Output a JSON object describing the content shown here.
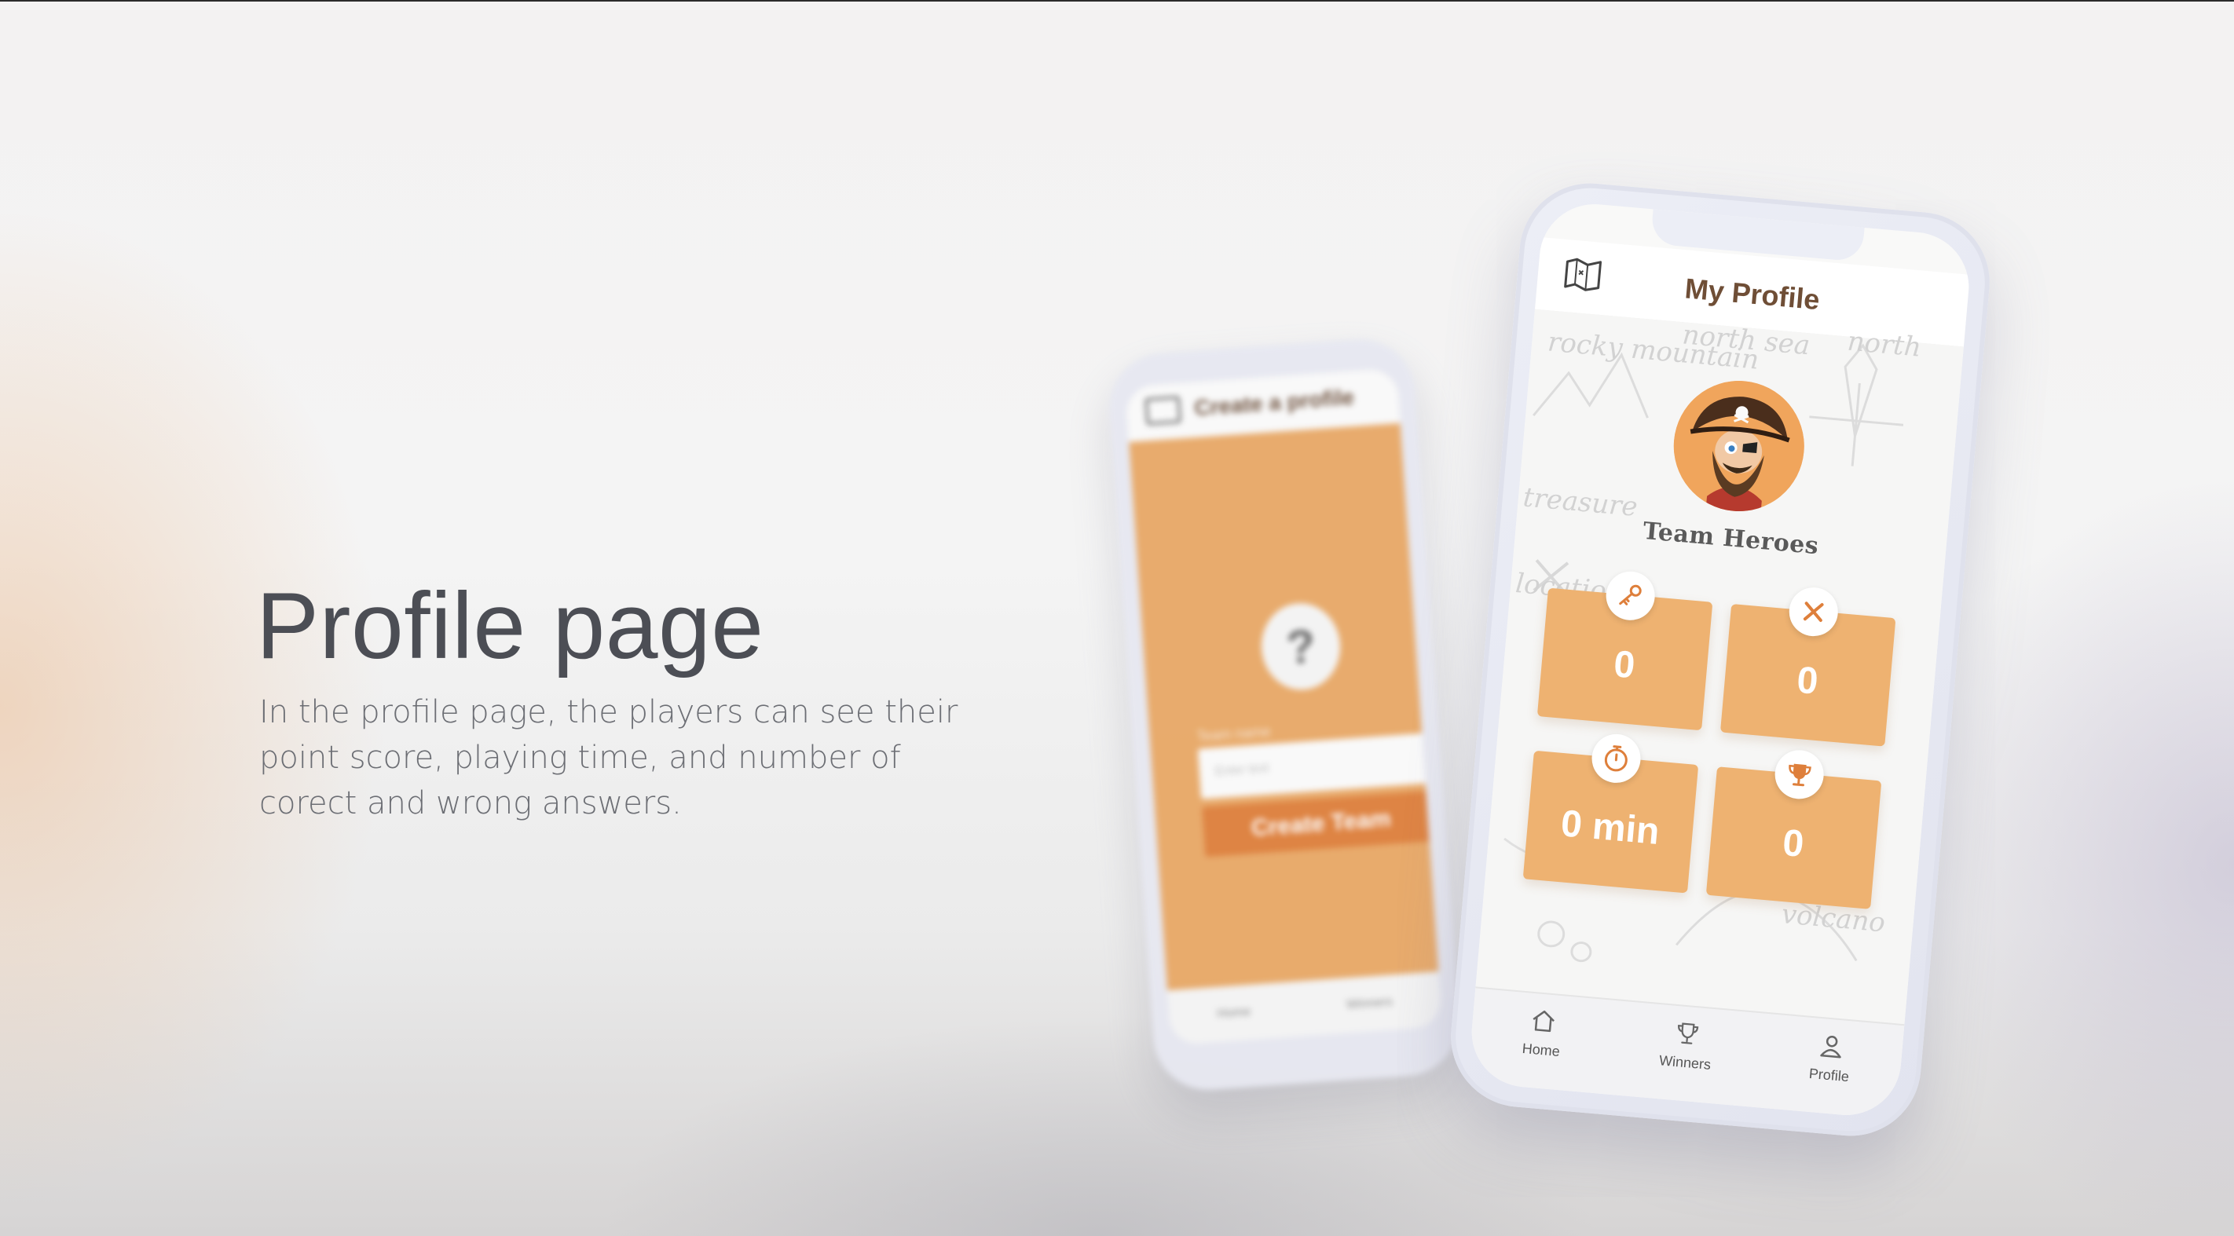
{
  "slide": {
    "title": "Profile page",
    "description": "In the profile page, the players can see their point score, playing time, and number of corect and wrong answers."
  },
  "back_phone": {
    "header_title": "Create a profile",
    "team_label": "Team name",
    "input_placeholder": "Enter text",
    "create_button": "Create Team",
    "nav": [
      "Home",
      "Winners"
    ]
  },
  "profile_screen": {
    "header_title": "My Profile",
    "team_name": "Team Heroes",
    "map_words": [
      "rocky mountain",
      "north sea",
      "north",
      "treasure",
      "location",
      "volcano"
    ],
    "stats": [
      {
        "icon": "key-icon",
        "value": "0"
      },
      {
        "icon": "wrong-x-icon",
        "value": "0"
      },
      {
        "icon": "stopwatch-icon",
        "value": "0 min"
      },
      {
        "icon": "trophy-icon",
        "value": "0"
      }
    ],
    "nav": {
      "home": "Home",
      "winners": "Winners",
      "profile": "Profile"
    },
    "colors": {
      "accent_orange": "#eeb271",
      "icon_orange": "#de7f3b",
      "title_brown": "#6f4e36"
    }
  }
}
